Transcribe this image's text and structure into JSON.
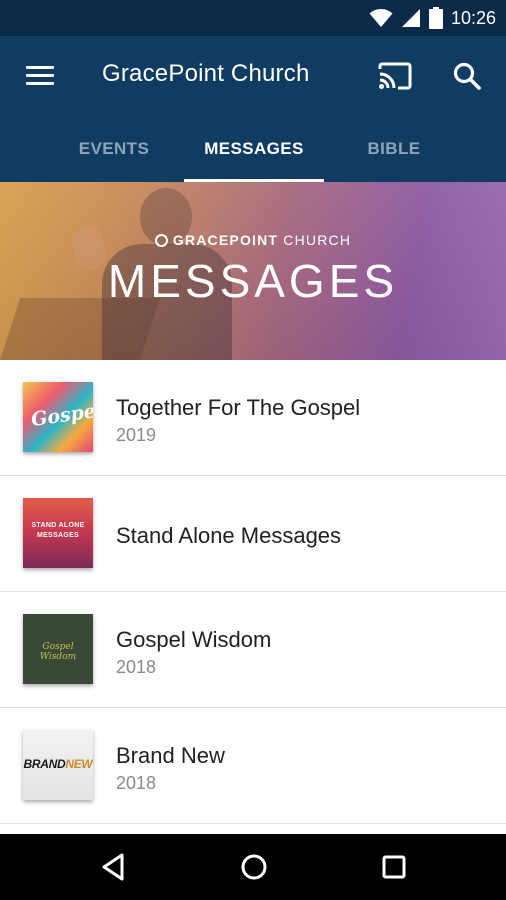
{
  "status_bar": {
    "time": "10:26"
  },
  "app_bar": {
    "title": "GracePoint Church"
  },
  "tabs": [
    {
      "label": "EVENTS",
      "active": false
    },
    {
      "label": "MESSAGES",
      "active": true
    },
    {
      "label": "BIBLE",
      "active": false
    }
  ],
  "banner": {
    "brand_bold": "GRACEPOINT",
    "brand_light": "CHURCH",
    "headline": "MESSAGES"
  },
  "messages": [
    {
      "title": "Together For The Gospel",
      "year": "2019",
      "thumb_text": "Gospel"
    },
    {
      "title": "Stand Alone Messages",
      "year": "",
      "thumb_text_1": "STAND ALONE",
      "thumb_text_2": "MESSAGES"
    },
    {
      "title": "Gospel Wisdom",
      "year": "2018",
      "thumb_text": "Gospel Wisdom"
    },
    {
      "title": "Brand New",
      "year": "2018",
      "thumb_text_1": "BRAND",
      "thumb_text_2": "NEW"
    }
  ],
  "colors": {
    "status_bar": "#0b2a47",
    "app_bar": "#113c61",
    "tab_inactive": "#8ea4ba",
    "tab_active": "#ffffff",
    "nav_bar": "#000000"
  },
  "icons": {
    "menu": "menu-icon",
    "cast": "cast-icon",
    "search": "search-icon",
    "wifi": "wifi-icon",
    "signal": "signal-icon",
    "battery": "battery-icon",
    "back": "back-icon",
    "home": "home-icon",
    "recents": "recents-icon"
  }
}
